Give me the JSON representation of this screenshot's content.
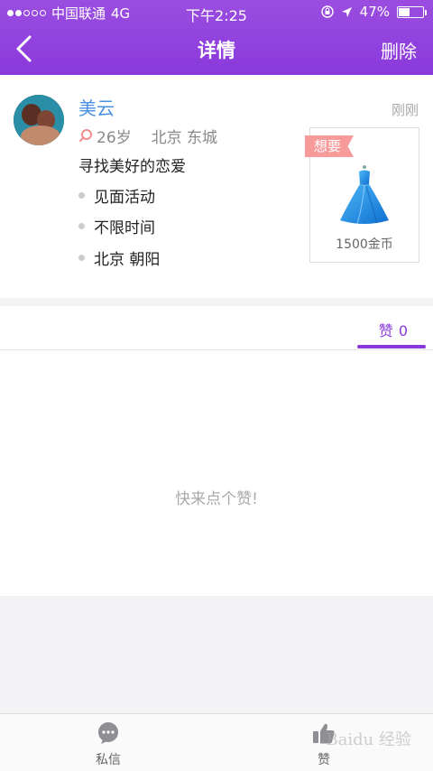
{
  "status": {
    "carrier": "中国联通",
    "network": "4G",
    "time": "下午2:25",
    "battery": "47%",
    "battery_level": 0.47
  },
  "nav": {
    "title": "详情",
    "delete_label": "删除"
  },
  "post": {
    "username": "美云",
    "time": "刚刚",
    "age": "26岁",
    "location": "北京 东城",
    "description": "寻找美好的恋爱",
    "details": [
      "见面活动",
      "不限时间",
      "北京 朝阳"
    ],
    "gift": {
      "tag": "想要",
      "price": "1500金币",
      "icon": "gown-icon"
    }
  },
  "tabs": {
    "like_label": "赞",
    "like_count": "0"
  },
  "empty_text": "快来点个赞!",
  "bottom_bar": {
    "message_label": "私信",
    "like_label": "赞"
  },
  "watermark": "Baidu 经验",
  "colors": {
    "primary": "#8a39db",
    "username": "#4a90e2",
    "tag": "#f69a9a",
    "gown": "#1e90e6"
  }
}
